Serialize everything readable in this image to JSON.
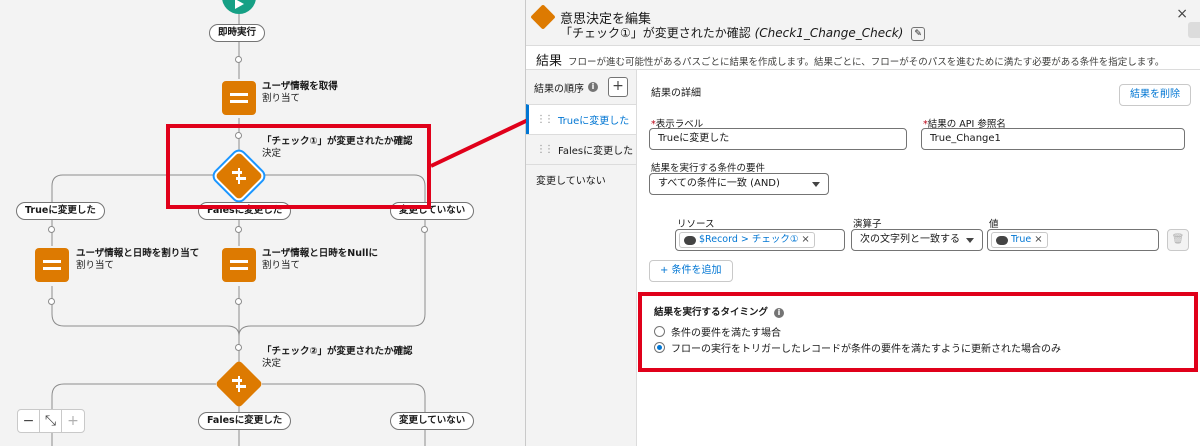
{
  "canvas": {
    "start_pill": "即時実行",
    "node_get_user": {
      "title": "ユーザ情報を取得",
      "type": "割り当て"
    },
    "decision1": {
      "title": "「チェック①」が変更されたか確認",
      "type": "決定"
    },
    "branch1": [
      "Trueに変更した",
      "Falesに変更した",
      "変更していない"
    ],
    "node_assign_date": {
      "title": "ユーザ情報と日時を割り当て",
      "type": "割り当て"
    },
    "node_assign_null": {
      "title": "ユーザ情報と日時をNullに",
      "type": "割り当て"
    },
    "decision2": {
      "title": "「チェック②」が変更されたか確認",
      "type": "決定"
    },
    "branch2": [
      "Falesに変更した",
      "変更していない"
    ],
    "zoom": {
      "minus": "−",
      "fit": "⤡",
      "plus": "+"
    }
  },
  "panel": {
    "header_title": "意思決定を編集",
    "header_subtitle": "「チェック①」が変更されたか確認",
    "header_api": "(Check1_Change_Check)",
    "close": "×",
    "section_title": "結果",
    "section_desc": "フローが進む可能性があるパスごとに結果を作成します。結果ごとに、フローがそのパスを進むために満たす必要がある条件を指定します。",
    "order_label": "結果の順序",
    "order_add": "+",
    "outcomes": [
      "Trueに変更した",
      "Falesに変更した",
      "変更していない"
    ],
    "detail_title": "結果の詳細",
    "delete_btn": "結果を削除",
    "label_label": "表示ラベル",
    "label_value": "Trueに変更した",
    "api_label": "結果の API 参照名",
    "api_value": "True_Change1",
    "req_label": "結果を実行する条件の要件",
    "req_value": "すべての条件に一致 (AND)",
    "cond_resource_label": "リソース",
    "cond_operator_label": "演算子",
    "cond_value_label": "値",
    "cond_resource": "$Record > チェック①",
    "cond_operator": "次の文字列と一致する",
    "cond_value": "True",
    "add_cond_btn": "+ 条件を追加",
    "timing_title": "結果を実行するタイミング",
    "timing_opt1": "条件の要件を満たす場合",
    "timing_opt2": "フローの実行をトリガーしたレコードが条件の要件を満たすように更新された場合のみ",
    "timing_selected": 2
  },
  "colors": {
    "accent": "#0176d3",
    "node_orange": "#dd7a01",
    "highlight": "#e0001a"
  }
}
